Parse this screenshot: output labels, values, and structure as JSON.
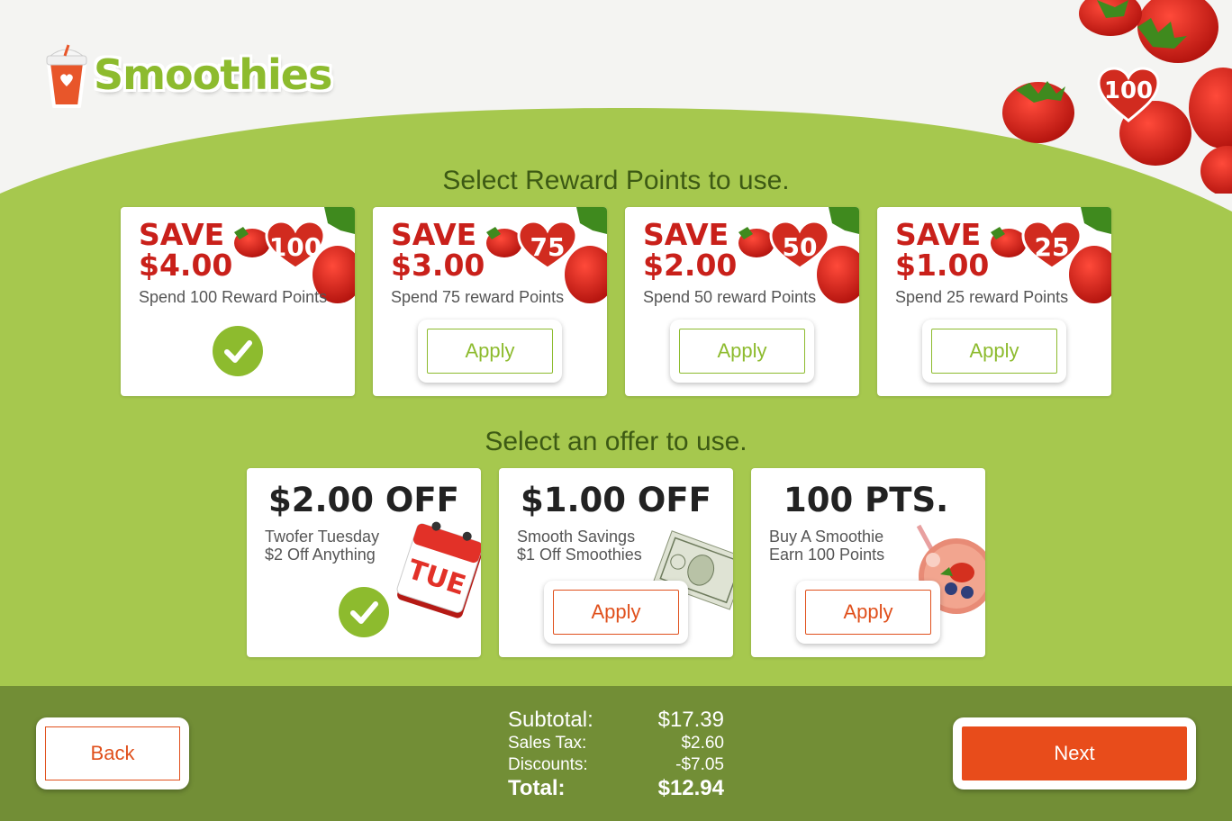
{
  "brand": {
    "name": "Smoothies",
    "green": "#8dbb2e",
    "red": "#c9201a",
    "orange": "#e84c1b"
  },
  "header": {
    "reward_points": "100"
  },
  "rewards": {
    "title": "Select Reward Points to use.",
    "cards": [
      {
        "save": "SAVE",
        "amount": "$4.00",
        "points": "100",
        "description": "Spend 100 Reward Points",
        "state": "selected"
      },
      {
        "save": "SAVE",
        "amount": "$3.00",
        "points": "75",
        "description": "Spend 75 reward Points",
        "state": "apply",
        "button": "Apply"
      },
      {
        "save": "SAVE",
        "amount": "$2.00",
        "points": "50",
        "description": "Spend 50 reward Points",
        "state": "apply",
        "button": "Apply"
      },
      {
        "save": "SAVE",
        "amount": "$1.00",
        "points": "25",
        "description": "Spend 25 reward Points",
        "state": "apply",
        "button": "Apply"
      }
    ]
  },
  "offers": {
    "title": "Select an offer to use.",
    "cards": [
      {
        "headline": "$2.00 OFF",
        "line1": "Twofer Tuesday",
        "line2": "$2 Off Anything",
        "image": "calendar-icon",
        "image_text": "TUE",
        "state": "selected"
      },
      {
        "headline": "$1.00 OFF",
        "line1": "Smooth Savings",
        "line2": "$1 Off Smoothies",
        "image": "dollar-bill-icon",
        "state": "apply",
        "button": "Apply"
      },
      {
        "headline": "100 PTS.",
        "line1": "Buy A Smoothie",
        "line2": "Earn 100 Points",
        "image": "smoothie-bowl-icon",
        "state": "apply",
        "button": "Apply"
      }
    ]
  },
  "totals": {
    "subtotal_label": "Subtotal:",
    "subtotal": "$17.39",
    "tax_label": "Sales Tax:",
    "tax": "$2.60",
    "discounts_label": "Discounts:",
    "discounts": "-$7.05",
    "total_label": "Total:",
    "total": "$12.94"
  },
  "footer": {
    "back_label": "Back",
    "next_label": "Next"
  }
}
